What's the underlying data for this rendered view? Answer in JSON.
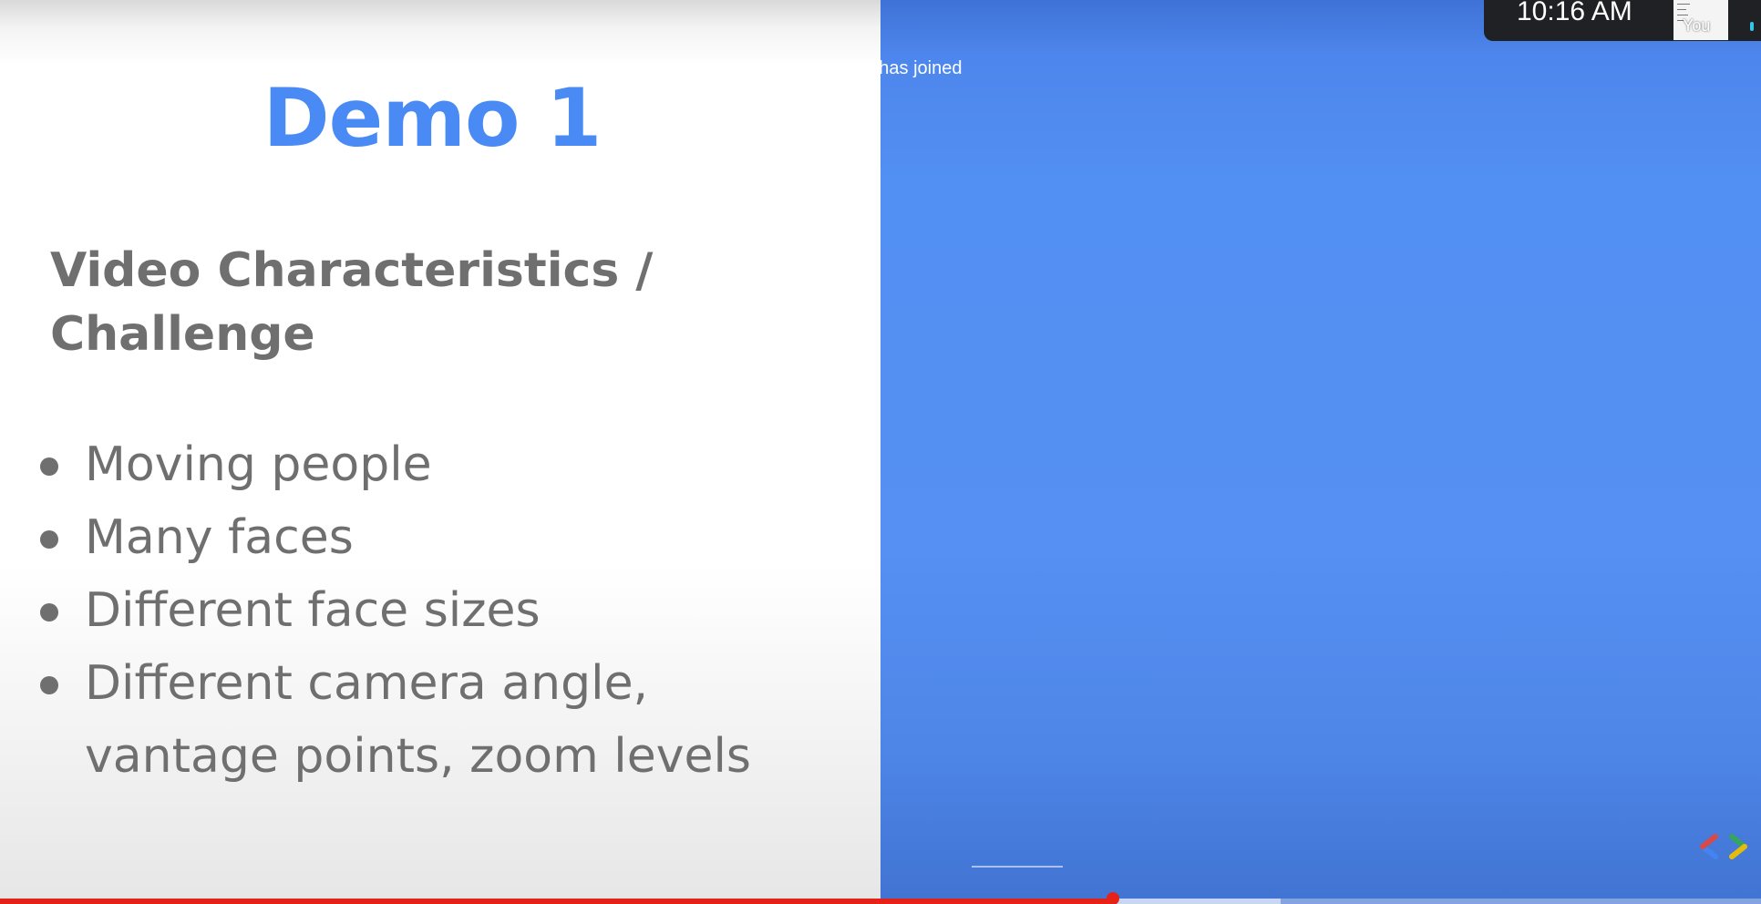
{
  "slide": {
    "title": "Demo 1",
    "subtitle": "Video Characteristics / Challenge",
    "bullets": [
      "Moving people",
      "Many faces",
      "Different face sizes",
      "Different camera angle, vantage points, zoom levels"
    ]
  },
  "meeting": {
    "status_text": "No one else has joined",
    "clock": "10:16 AM",
    "self_label": "You"
  },
  "player": {
    "progress": 0.632,
    "buffered": 0.727
  },
  "colors": {
    "title": "#4a8af4",
    "body_text": "#6f6f6f",
    "pane_blue": "#5590f2",
    "progress_red": "#e62117"
  },
  "icons": {
    "bullet": "bullet-dot-icon",
    "logo": "google-developers-logo"
  }
}
